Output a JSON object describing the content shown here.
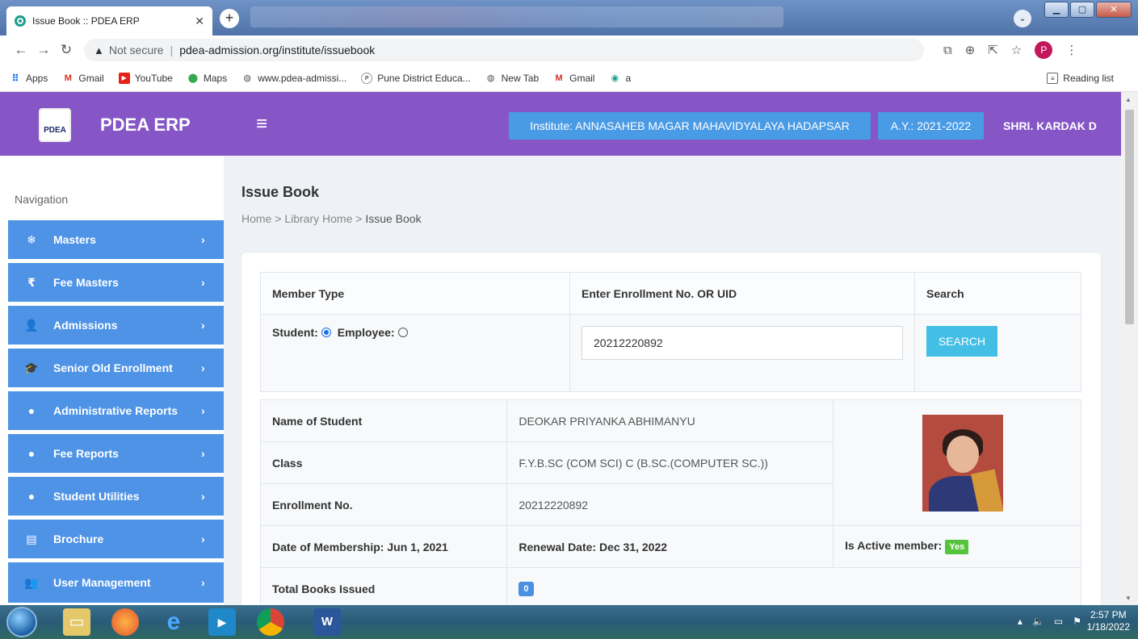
{
  "browser": {
    "tab_title": "Issue Book :: PDEA ERP",
    "new_tab_symbol": "+",
    "url_warning": "Not secure",
    "url": "pdea-admission.org/institute/issuebook",
    "profile_initial": "P",
    "bookmarks": [
      {
        "label": "Apps",
        "icon": "apps-grid-icon"
      },
      {
        "label": "Gmail",
        "icon": "gmail-icon"
      },
      {
        "label": "YouTube",
        "icon": "youtube-icon"
      },
      {
        "label": "Maps",
        "icon": "maps-pin-icon"
      },
      {
        "label": "www.pdea-admissi...",
        "icon": "globe-icon"
      },
      {
        "label": "Pune District Educa...",
        "icon": "pdea-seal-icon"
      },
      {
        "label": "New Tab",
        "icon": "globe-icon"
      },
      {
        "label": "Gmail",
        "icon": "gmail-icon"
      },
      {
        "label": "a",
        "icon": "site-icon"
      }
    ],
    "reading_list": "Reading list"
  },
  "header": {
    "brand": "PDEA ERP",
    "logo_text": "PDEA",
    "institute": "Institute: ANNASAHEB MAGAR MAHAVIDYALAYA HADAPSAR",
    "academic_year": "A.Y.: 2021-2022",
    "user": "SHRI. KARDAK D",
    "color": "#8656c7",
    "badge_color": "#4a9be6"
  },
  "sidebar": {
    "title": "Navigation",
    "color": "#4e93e6",
    "items": [
      {
        "label": "Masters",
        "icon": "snowflake-icon"
      },
      {
        "label": "Fee Masters",
        "icon": "rupee-icon"
      },
      {
        "label": "Admissions",
        "icon": "user-plus-icon"
      },
      {
        "label": "Senior Old Enrollment",
        "icon": "graduation-cap-icon"
      },
      {
        "label": "Administrative Reports",
        "icon": "alert-circle-icon"
      },
      {
        "label": "Fee Reports",
        "icon": "alert-circle-icon"
      },
      {
        "label": "Student Utilities",
        "icon": "alert-circle-icon"
      },
      {
        "label": "Brochure",
        "icon": "brochure-icon"
      },
      {
        "label": "User Management",
        "icon": "users-icon"
      }
    ]
  },
  "main": {
    "title": "Issue Book",
    "breadcrumb": [
      "Home",
      "Library Home",
      "Issue Book"
    ],
    "search_form": {
      "col_member_type": "Member Type",
      "col_enroll": "Enter Enrollment No. OR UID",
      "col_search": "Search",
      "radio_student": "Student:",
      "radio_employee": "Employee:",
      "selected": "Student",
      "enroll_value": "20212220892",
      "search_button": "SEARCH"
    },
    "member": {
      "name_label": "Name of Student",
      "name": "DEOKAR PRIYANKA ABHIMANYU",
      "class_label": "Class",
      "class": "F.Y.B.SC (COM SCI) C (B.SC.(COMPUTER SC.))",
      "enroll_label": "Enrollment No.",
      "enroll": "20212220892",
      "membership_date": "Date of Membership: Jun 1, 2021",
      "renewal_date": "Renewal Date: Dec 31, 2022",
      "active_label": "Is Active member:",
      "active_value": "Yes",
      "books_issued_label": "Total Books Issued",
      "books_issued": "0"
    }
  },
  "taskbar": {
    "time": "2:57 PM",
    "date": "1/18/2022"
  }
}
